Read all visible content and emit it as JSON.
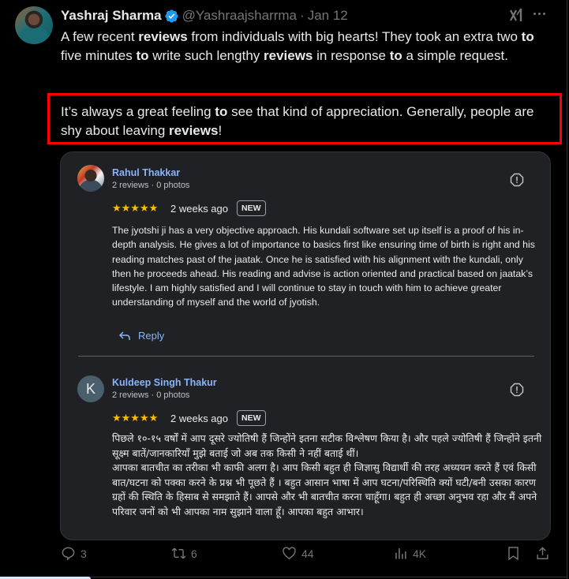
{
  "tweet": {
    "author_name": "Yashraj Sharma",
    "handle": "@Yashraajsharrma",
    "separator": "·",
    "date": "Jan 12",
    "text_segments": [
      {
        "t": "A few recent ",
        "b": false
      },
      {
        "t": "reviews",
        "b": true
      },
      {
        "t": " from individuals with big hearts! They took an extra two ",
        "b": false
      },
      {
        "t": "to",
        "b": true
      },
      {
        "t": " five minutes ",
        "b": false
      },
      {
        "t": "to",
        "b": true
      },
      {
        "t": " write such lengthy ",
        "b": false
      },
      {
        "t": "reviews",
        "b": true
      },
      {
        "t": " in response ",
        "b": false
      },
      {
        "t": "to",
        "b": true
      },
      {
        "t": " a simple request.",
        "b": false
      }
    ],
    "highlighted_segments": [
      {
        "t": "It’s always a great feeling ",
        "b": false
      },
      {
        "t": "to",
        "b": true
      },
      {
        "t": " see that kind of appreciation. Generally, people are shy about leaving ",
        "b": false
      },
      {
        "t": "reviews",
        "b": true
      },
      {
        "t": "!",
        "b": false
      }
    ],
    "highlight_color": "#ff0000"
  },
  "reviews": [
    {
      "name": "Rahul Thakkar",
      "meta": "2 reviews · 0 photos",
      "stars": "★★★★★",
      "rating": 5,
      "time": "2 weeks ago",
      "badge": "NEW",
      "body": "The jyotshi ji has a very objective approach. His kundali software set up itself is a proof of his in-depth analysis. He gives a lot of importance to basics first like ensuring time of birth is right and his reading matches past of the jaatak. Once he is satisfied with his alignment with the kundali, only then he proceeds ahead. His reading and advise is action oriented and practical based on jaatak’s lifestyle. I am highly satisfied and I will continue to stay in touch with him to achieve greater understanding of myself and the world of jyotish.",
      "reply_label": "Reply"
    },
    {
      "name": "Kuldeep Singh Thakur",
      "avatar_letter": "K",
      "meta": "2 reviews · 0 photos",
      "stars": "★★★★★",
      "rating": 5,
      "time": "2 weeks ago",
      "badge": "NEW",
      "body": "पिछले १०-१५ वर्षों में आप दूसरे ज्योतिषी हैं जिन्होंने इतना सटीक विश्लेषण किया है। और पहले ज्योतिषी हैं जिन्होंने इतनी सूक्ष्म बातें/जानकारियाँ मुझे बताई जो अब तक किसी ने नहीं बताई थीं।\nआपका बातचीत का तरीका भी काफी अलग है। आप किसी बहुत ही जिज्ञासु विद्यार्थी की तरह अध्ययन करते हैं एवं किसी बात/घटना को पक्का करने के प्रश्न भी पूछते हैं । बहुत आसान भाषा में आप घटना/परिस्थिति क्यों घटी/बनी उसका कारण ग्रहों की स्थिति के हिसाब से समझाते हैं। आपसे और भी बातचीत करना चाहूँगा। बहुत ही अच्छा अनुभव रहा और मैं अपने परिवार जनों को भी आपका नाम सुझाने वाला हूँ। आपका बहुत आभार।"
    }
  ],
  "actions": {
    "replies": "3",
    "reposts": "6",
    "likes": "44",
    "views": "4K"
  },
  "colors": {
    "link_blue": "#8ab4f8",
    "star_yellow": "#fbbc04",
    "verified_blue": "#1d9bf0"
  }
}
